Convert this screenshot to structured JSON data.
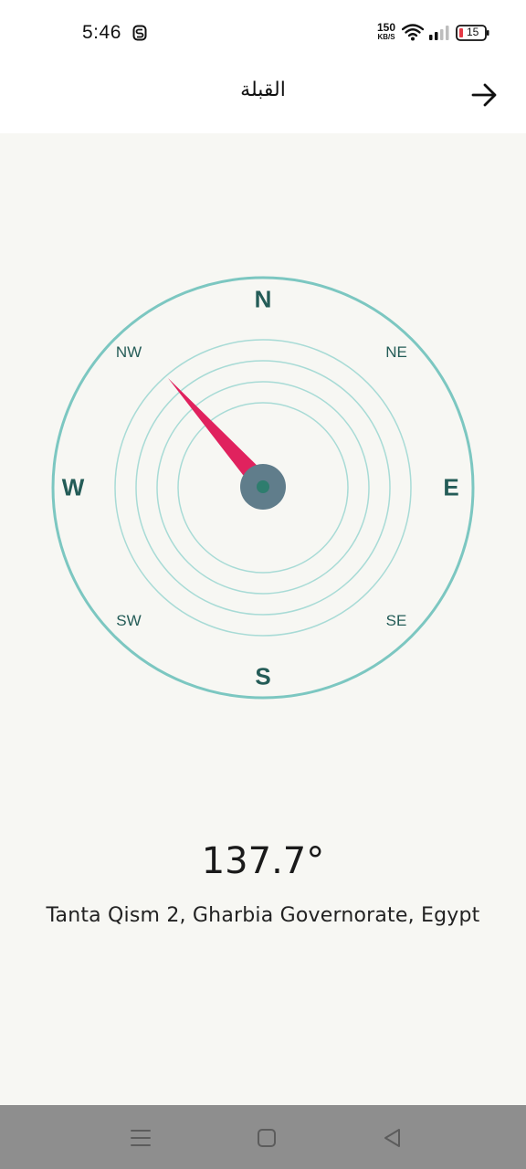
{
  "status_bar": {
    "time": "5:46",
    "net_speed": "150",
    "net_speed_unit": "KB/S",
    "battery": "15",
    "icons": [
      "s-notification-icon",
      "wifi-icon",
      "signal-icon",
      "battery-icon"
    ],
    "battery_color": "#e53945"
  },
  "header": {
    "title": "القبلة",
    "back_icon": "arrow-right-icon"
  },
  "compass": {
    "labels": {
      "n": "N",
      "ne": "NE",
      "e": "E",
      "se": "SE",
      "s": "S",
      "sw": "SW",
      "w": "W",
      "nw": "NW"
    },
    "needle_bearing_deg": 137.7,
    "ring_color": "#7cc7c1",
    "needle_color": "#e0225e",
    "hub_color": "#607d8b",
    "hub_dot_color": "#2e7d6e",
    "label_color": "#245c57"
  },
  "info": {
    "bearing": "137.7°",
    "location": "Tanta Qism 2, Gharbia Governorate, Egypt"
  },
  "nav_bar": {
    "icons": [
      "menu-icon",
      "home-square-icon",
      "back-triangle-icon"
    ]
  }
}
